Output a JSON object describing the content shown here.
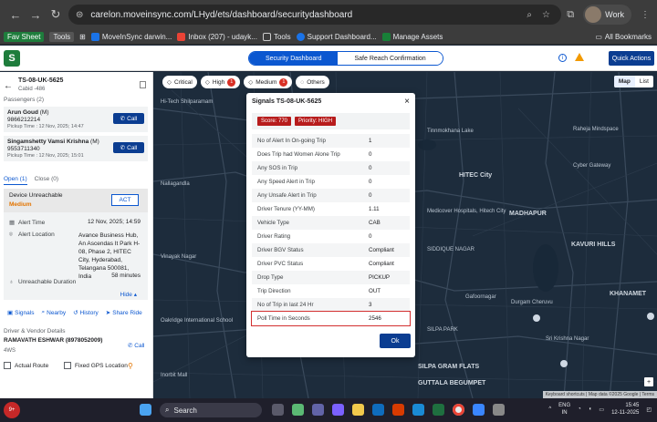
{
  "browser": {
    "url": "carelon.moveinsync.com/LHyd/ets/dashboard/securitydashboard",
    "profile": "Work",
    "bookmarks": [
      "Fav Sheet",
      "Tools",
      "MoveInSync darwin...",
      "Inbox (207) - udayk...",
      "Tools",
      "Support Dashboard...",
      "Manage Assets"
    ],
    "all_bookmarks": "All Bookmarks"
  },
  "header": {
    "tabs": [
      "Security Dashboard",
      "Safe Reach Confirmation"
    ],
    "quick_actions": "Quick Actions"
  },
  "trip": {
    "id": "TS-08-UK-5625",
    "cab": "Cabid -486",
    "passengers_title": "Passengers (2)",
    "passengers": [
      {
        "name": "Arun Goud",
        "gender": "(M)",
        "phone": "9866212214",
        "pickup": "Pickup Time : 12 Nov, 2025; 14:47"
      },
      {
        "name": "Singamshetty Vamsi Krishna",
        "gender": "(M)",
        "phone": "9553711340",
        "pickup": "Pickup Time : 12 Nov, 2025; 15:01"
      }
    ],
    "call_label": "Call"
  },
  "alerts": {
    "tab_open": "Open (1)",
    "tab_close": "Close (0)",
    "name": "Device Unreachable",
    "severity": "Medium",
    "act": "ACT",
    "alert_time_label": "Alert Time",
    "alert_time": "12 Nov, 2025; 14:59",
    "location_label": "Alert Location",
    "location": "Avance Business Hub, An Ascendas It Park H-08, Phase 2, HITEC City, Hyderabad, Telangana 500081, India",
    "duration_label": "Unreachable Duration",
    "duration": "58 minutes",
    "hide": "Hide"
  },
  "actions": [
    "Signals",
    "Nearby",
    "History",
    "Share Ride"
  ],
  "driver": {
    "title": "Driver & Vendor Details",
    "name": "RAMAVATH ESHWAR (8978052009)",
    "sub": "4WS",
    "call": "Call",
    "actual_route": "Actual Route",
    "fixed_gps": "Fixed GPS Location"
  },
  "map": {
    "chips": [
      {
        "label": "Critical",
        "count": "0",
        "has_count": false
      },
      {
        "label": "High",
        "count": "1",
        "has_count": true
      },
      {
        "label": "Medium",
        "count": "1",
        "has_count": true
      },
      {
        "label": "Others",
        "count": "0",
        "has_count": false
      }
    ],
    "toggle": [
      "Map",
      "List"
    ],
    "labels": [
      "Hi-Tech Shilparamam",
      "Tinnmokhana Lake",
      "HITEC City",
      "MADHAPUR",
      "KAVURI HILLS",
      "Medicover Hospitals, Hitech City",
      "SIDDIQUE NAGAR",
      "SILPA GRAM FLATS",
      "GUTTALA BEGUMPET",
      "Sri Krishna Nagar",
      "Durgam Cheruvu",
      "Gafoornagar",
      "KHANAMET",
      "SILPA PARK",
      "Nallagandla",
      "Vinayak Nagar",
      "Oakridge International School",
      "Raheja Mindspace",
      "Cyber Gateway",
      "Inorbit Mall"
    ],
    "attribution": "Keyboard shortcuts | Map data ©2025 Google | Terms"
  },
  "modal": {
    "title": "Signals TS-08-UK-5625",
    "score": "Score: 770",
    "priority": "Priority: HIGH",
    "rows": [
      {
        "k": "No of Alert In On-going Trip",
        "v": "1"
      },
      {
        "k": "Does Trip had Women Alone Trip",
        "v": "0"
      },
      {
        "k": "Any SOS in Trip",
        "v": "0"
      },
      {
        "k": "Any Speed Alert in Trip",
        "v": "0"
      },
      {
        "k": "Any Unsafe Alert in Trip",
        "v": "0"
      },
      {
        "k": "Driver Tenure (YY-MM)",
        "v": "1.11"
      },
      {
        "k": "Vehicle Type",
        "v": "CAB"
      },
      {
        "k": "Driver Rating",
        "v": "0"
      },
      {
        "k": "Driver BGV Status",
        "v": "Compliant"
      },
      {
        "k": "Driver PVC Status",
        "v": "Compliant"
      },
      {
        "k": "Drop Type",
        "v": "PICKUP"
      },
      {
        "k": "Trip Direction",
        "v": "OUT"
      },
      {
        "k": "No of Trip in last 24 Hr",
        "v": "3"
      },
      {
        "k": "Poll Time in Seconds",
        "v": "2546"
      }
    ],
    "ok": "Ok"
  },
  "taskbar": {
    "search": "Search",
    "lang1": "ENG",
    "lang2": "IN",
    "time": "15:45",
    "date": "12-11-2025",
    "weather": "9+"
  }
}
